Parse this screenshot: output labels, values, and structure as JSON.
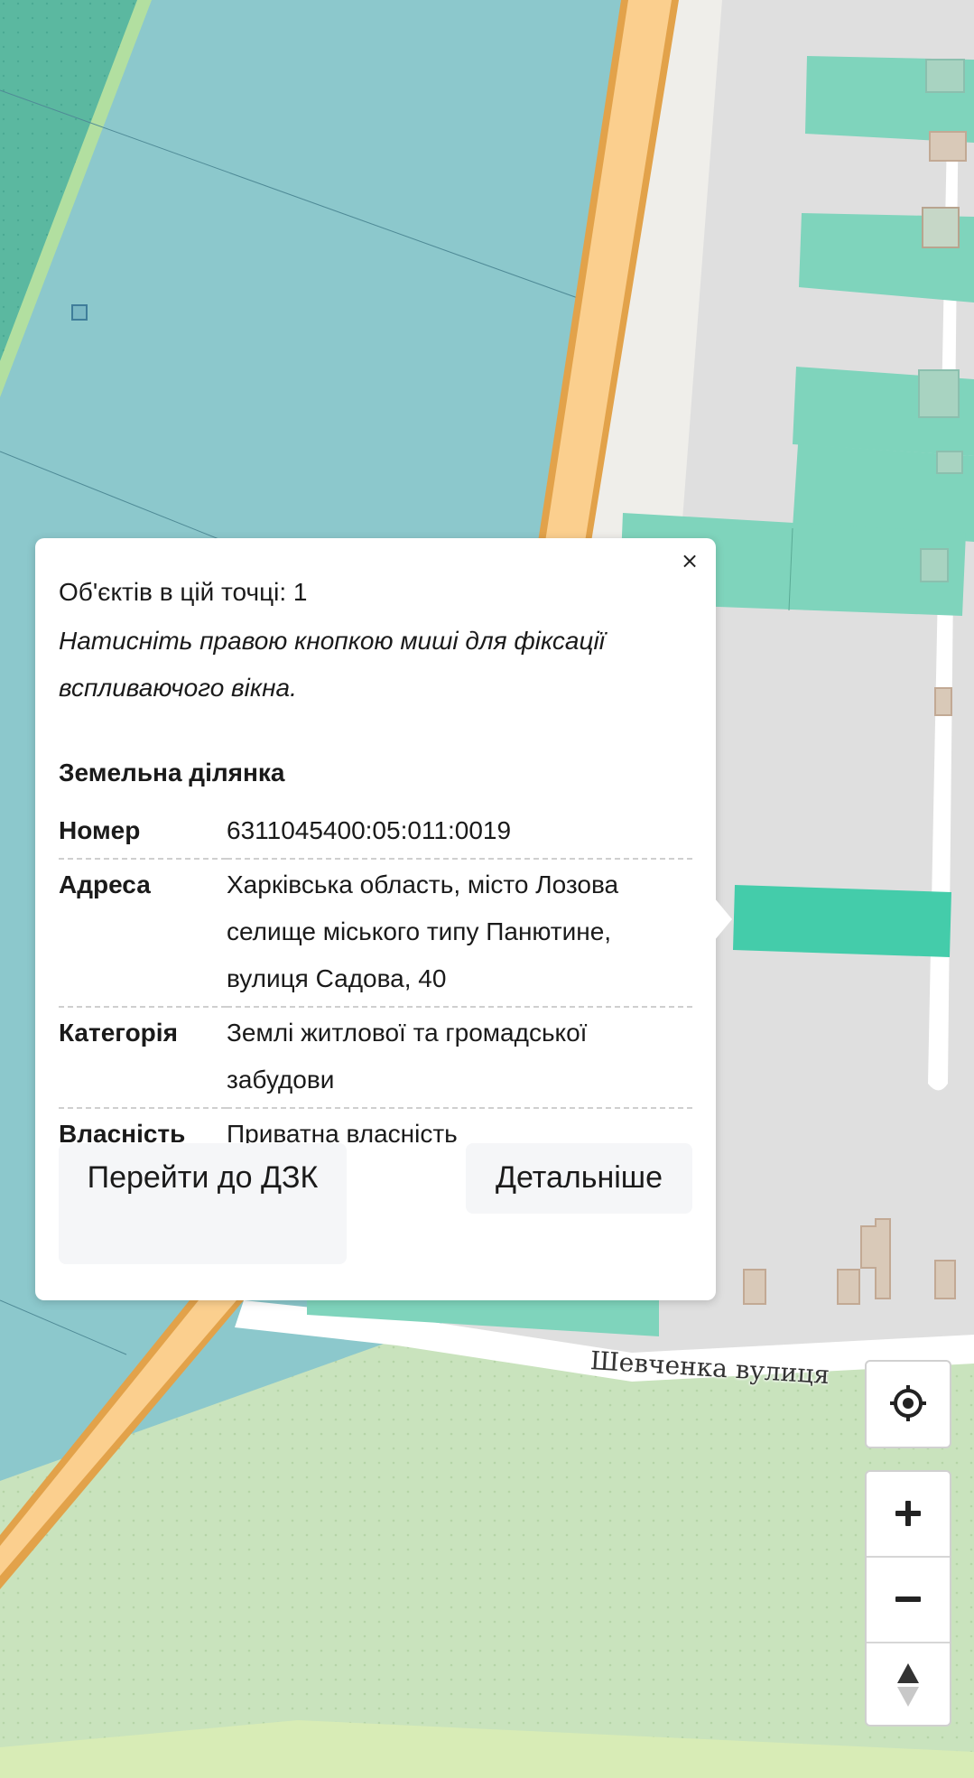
{
  "popup": {
    "close_label": "×",
    "count_line": "Об'єктів в цій точці: 1",
    "hint_line": "Натисніть правою кнопкою миші для фіксації вспливаючого вікна.",
    "section_title": "Земельна ділянка",
    "attributes": [
      {
        "key": "Номер",
        "value": "6311045400:05:011:0019"
      },
      {
        "key": "Адреса",
        "value": "Харківська область, місто Лозова селище міського типу Панютине, вулиця Садова, 40"
      },
      {
        "key": "Категорія",
        "value": "Землі житлової та громадської забудови"
      },
      {
        "key": "Власність",
        "value": "Приватна власність"
      }
    ],
    "buttons": {
      "goto_dzk": "Перейти до ДЗК",
      "details": "Детальніше"
    }
  },
  "map": {
    "road_label": "Шевченка вулиця",
    "colors": {
      "background": "#dfdfdf",
      "farmland": "#8cc8cc",
      "park": "#c9e3bd",
      "road_casing": "#e2a24a",
      "road_fill": "#fbcf8e",
      "parcel": "#7fd4bc",
      "selected_parcel": "#44ccaa",
      "building": "#d9c9b8"
    }
  },
  "controls": {
    "locate_icon": "locate-crosshair-icon",
    "zoom_in_icon": "plus-icon",
    "zoom_out_icon": "minus-icon",
    "compass_icon": "compass-north-icon"
  }
}
